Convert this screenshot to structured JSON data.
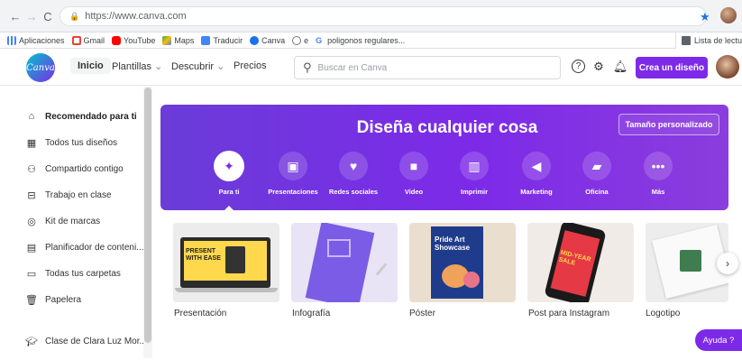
{
  "browser": {
    "url": "https://www.canva.com",
    "bookmarks": [
      "Aplicaciones",
      "Gmail",
      "YouTube",
      "Maps",
      "Traducir",
      "Canva",
      "e",
      "poligonos regulares..."
    ],
    "reading_list": "Lista de lectu"
  },
  "header": {
    "logo": "Canva",
    "nav": [
      "Inicio",
      "Plantillas",
      "Descubrir",
      "Precios"
    ],
    "search_placeholder": "Buscar en Canva",
    "create_button": "Crea un diseño",
    "icons": [
      "help-icon",
      "settings-icon",
      "bell-icon"
    ]
  },
  "sidebar": {
    "items": [
      {
        "label": "Recomendado para ti",
        "icon": "home-icon",
        "active": true
      },
      {
        "label": "Todos tus diseños",
        "icon": "grid-icon"
      },
      {
        "label": "Compartido contigo",
        "icon": "people-icon"
      },
      {
        "label": "Trabajo en clase",
        "icon": "class-icon"
      },
      {
        "label": "Kit de marcas",
        "icon": "brand-icon"
      },
      {
        "label": "Planificador de conteni...",
        "icon": "calendar-icon"
      },
      {
        "label": "Todas tus carpetas",
        "icon": "folder-icon"
      },
      {
        "label": "Papelera",
        "icon": "trash-icon"
      }
    ],
    "team": {
      "label": "Clase de Clara Luz Mor...",
      "icon": "graduation-cap-icon"
    }
  },
  "hero": {
    "title": "Diseña cualquier cosa",
    "custom_size": "Tamaño personalizado",
    "categories": [
      {
        "label": "Para ti",
        "icon": "sparkle-icon",
        "selected": true
      },
      {
        "label": "Presentaciones",
        "icon": "presentation-icon"
      },
      {
        "label": "Redes sociales",
        "icon": "heart-chat-icon"
      },
      {
        "label": "Video",
        "icon": "video-icon"
      },
      {
        "label": "Imprimir",
        "icon": "print-icon"
      },
      {
        "label": "Marketing",
        "icon": "megaphone-icon"
      },
      {
        "label": "Oficina",
        "icon": "briefcase-icon"
      },
      {
        "label": "Más",
        "icon": "more-icon"
      }
    ]
  },
  "cards": [
    {
      "label": "Presentación",
      "thumb_text": "PRESENT WITH EASE"
    },
    {
      "label": "Infografía",
      "thumb_text": ""
    },
    {
      "label": "Póster",
      "thumb_text": "Pride Art Showcase"
    },
    {
      "label": "Post para Instagram",
      "thumb_text": "MID-YEAR SALE"
    },
    {
      "label": "Logotipo",
      "thumb_text": ""
    }
  ],
  "help_button": "Ayuda ?",
  "colors": {
    "brand_purple": "#7d2ae8",
    "canva_teal": "#00c4cc"
  }
}
